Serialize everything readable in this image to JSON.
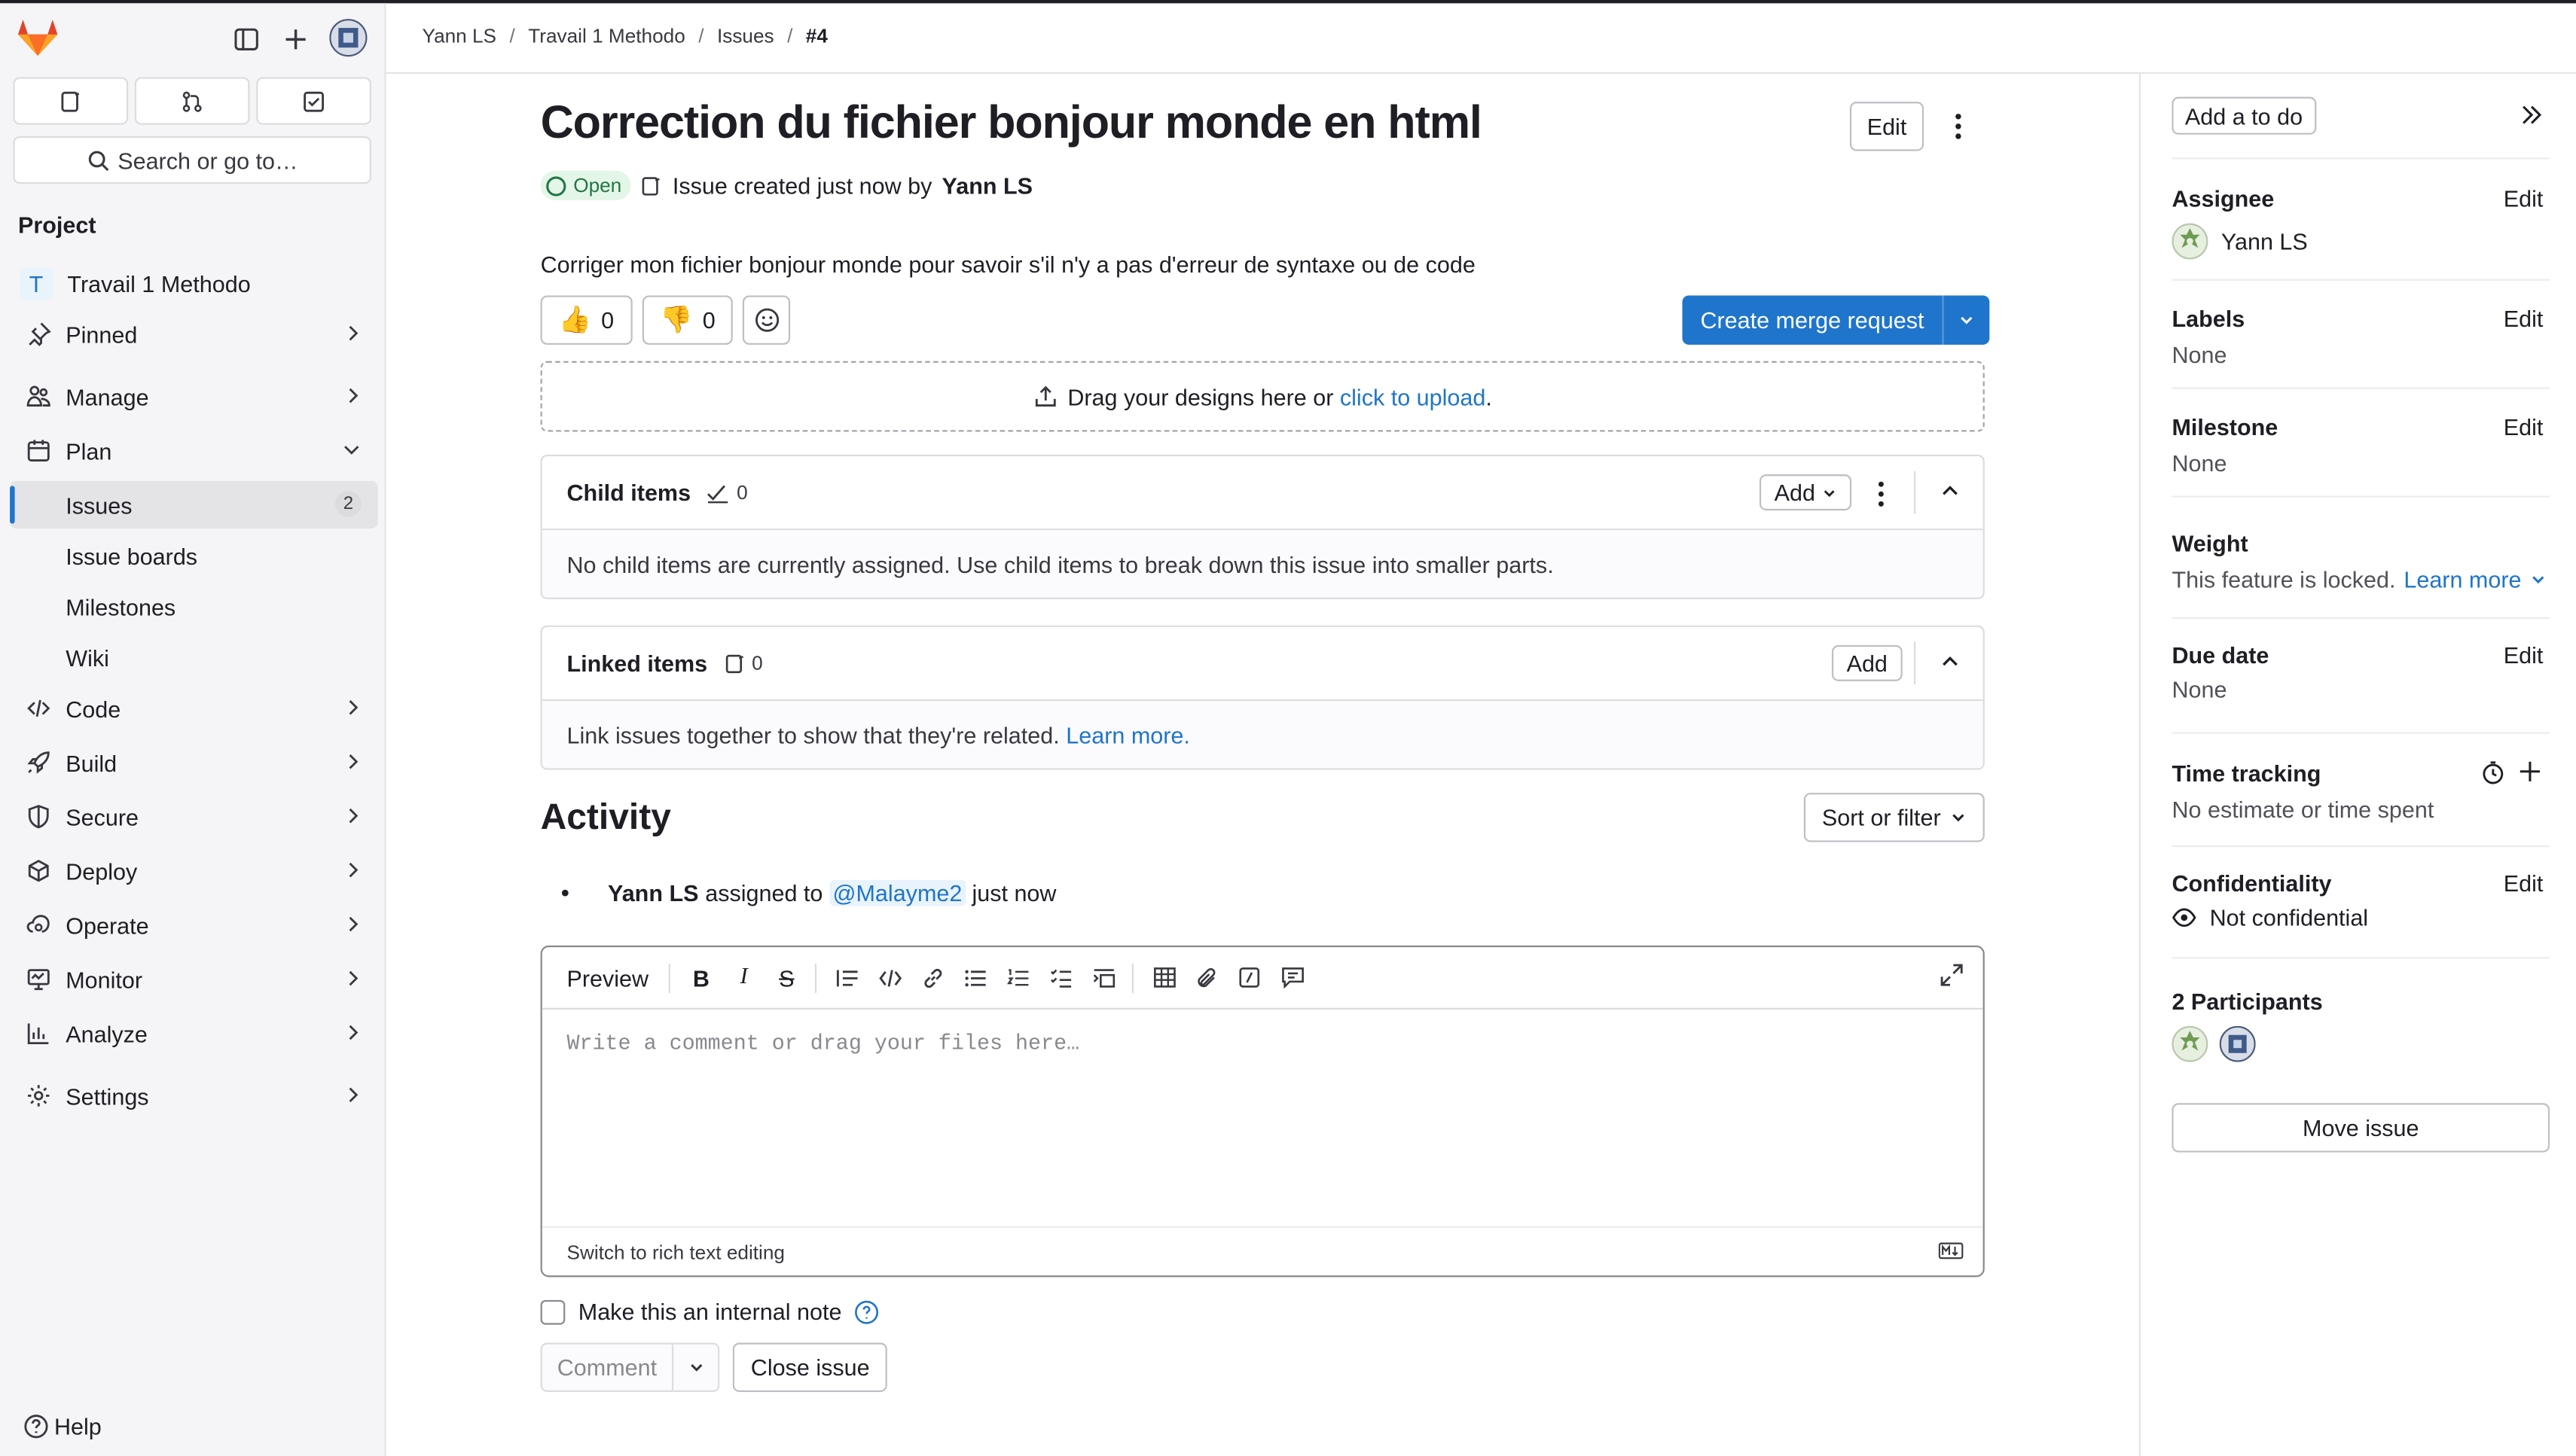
{
  "breadcrumbs": [
    "Yann LS",
    "Travail 1 Methodo",
    "Issues",
    "#4"
  ],
  "sidebar": {
    "search_label": "Search or go to…",
    "section_title": "Project",
    "project_initial": "T",
    "project_name": "Travail 1 Methodo",
    "pinned": "Pinned",
    "manage": "Manage",
    "plan": "Plan",
    "issues": "Issues",
    "issues_count": "2",
    "issue_boards": "Issue boards",
    "milestones": "Milestones",
    "wiki": "Wiki",
    "code": "Code",
    "build": "Build",
    "secure": "Secure",
    "deploy": "Deploy",
    "operate": "Operate",
    "monitor": "Monitor",
    "analyze": "Analyze",
    "settings": "Settings",
    "help": "Help"
  },
  "issue": {
    "title": "Correction du fichier bonjour monde en html",
    "edit_label": "Edit",
    "status": "Open",
    "created_prefix": "Issue created just now by",
    "author": "Yann LS",
    "description": "Corriger mon fichier bonjour monde pour savoir s'il n'y a pas d'erreur de syntaxe ou de code",
    "thumbs_up": "0",
    "thumbs_down": "0",
    "create_mr_label": "Create merge request",
    "dropzone_text": "Drag your designs here or",
    "dropzone_link": "click to upload",
    "dropzone_end": "."
  },
  "child_items": {
    "title": "Child items",
    "count": "0",
    "add_label": "Add",
    "empty": "No child items are currently assigned. Use child items to break down this issue into smaller parts."
  },
  "linked_items": {
    "title": "Linked items",
    "count": "0",
    "add_label": "Add",
    "empty": "Link issues together to show that they're related.",
    "learn_more": "Learn more."
  },
  "activity": {
    "title": "Activity",
    "sort_label": "Sort or filter",
    "entry_actor": "Yann LS",
    "entry_action": "assigned to",
    "entry_target": "@Malayme2",
    "entry_time": "just now"
  },
  "editor": {
    "preview_label": "Preview",
    "placeholder": "Write a comment or drag your files here…",
    "switch_label": "Switch to rich text editing",
    "internal_note": "Make this an internal note",
    "comment_label": "Comment",
    "close_label": "Close issue"
  },
  "right_sidebar": {
    "todo_label": "Add a to do",
    "edit_label": "Edit",
    "assignee_label": "Assignee",
    "assignee_name": "Yann LS",
    "labels_label": "Labels",
    "labels_value": "None",
    "milestone_label": "Milestone",
    "milestone_value": "None",
    "weight_label": "Weight",
    "weight_value": "This feature is locked.",
    "weight_link": "Learn more",
    "due_label": "Due date",
    "due_value": "None",
    "time_label": "Time tracking",
    "time_value": "No estimate or time spent",
    "conf_label": "Confidentiality",
    "conf_value": "Not confidential",
    "participants_label": "2 Participants",
    "move_label": "Move issue"
  },
  "colors": {
    "brand_orange": "#e24329",
    "accent_blue": "#1f75cb",
    "open_green": "#217645"
  }
}
